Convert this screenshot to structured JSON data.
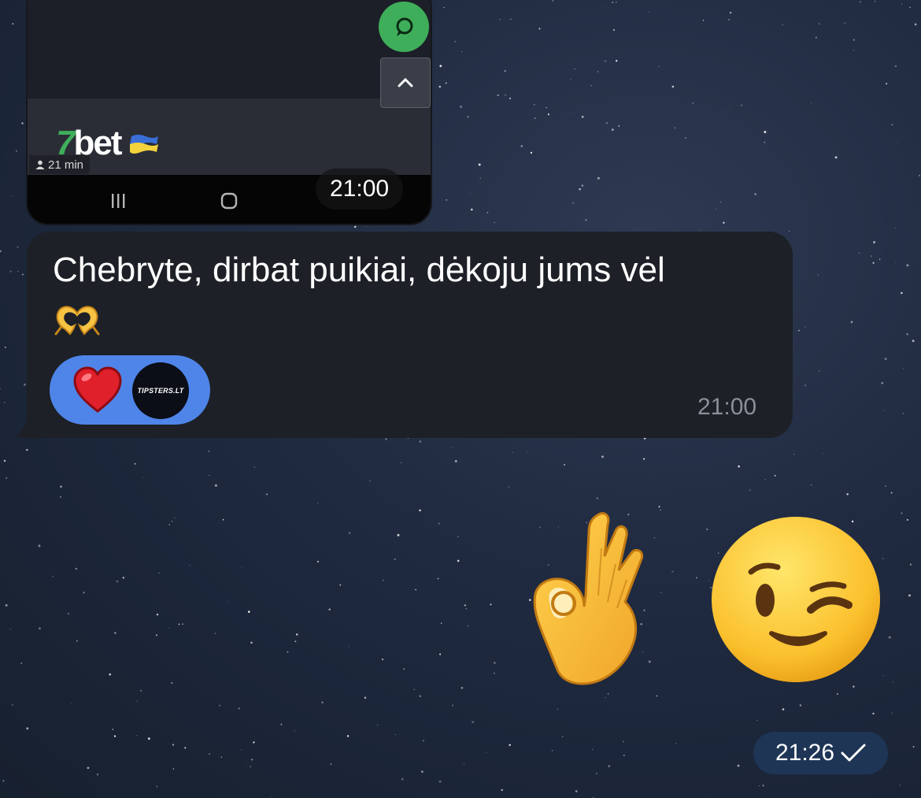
{
  "screenshot_message": {
    "read_time": "21 min",
    "time": "21:00",
    "logo_prefix": "7",
    "logo_suffix": "bet"
  },
  "text_message": {
    "text": "Chebryte, dirbat puikiai, dėkoju jums vėl",
    "emoji_name": "heart-hands",
    "reactions": {
      "emoji": "heart",
      "avatar_text": "TIPSTERS.LT",
      "color": "#4f85e8"
    },
    "time": "21:00"
  },
  "outgoing_message": {
    "emojis": [
      "ok-hand",
      "winking-face"
    ],
    "time": "21:26",
    "status": "sent-check"
  },
  "colors": {
    "background": "#1f2a40",
    "incoming_bubble": "#1d2026",
    "outgoing_time_pill": "#1e3556",
    "accent_green": "#3fae5a"
  }
}
